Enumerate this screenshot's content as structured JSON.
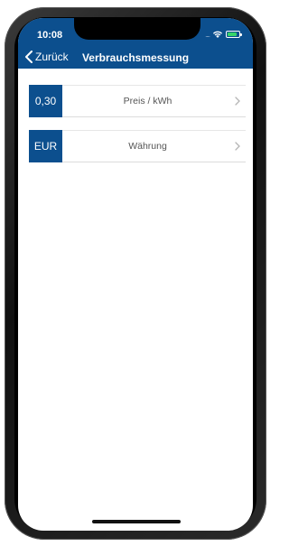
{
  "status_bar": {
    "time": "10:08",
    "signal_dots": "....",
    "battery_color": "#36d46a"
  },
  "nav": {
    "back_label": "Zurück",
    "title": "Verbrauchsmessung",
    "bar_color": "#0c4f8e"
  },
  "settings": [
    {
      "value": "0,30",
      "label": "Preis / kWh"
    },
    {
      "value": "EUR",
      "label": "Währung"
    }
  ],
  "icons": {
    "back": "chevron-left-icon",
    "row": "chevron-right-icon",
    "wifi": "wifi-icon",
    "battery": "battery-icon"
  }
}
